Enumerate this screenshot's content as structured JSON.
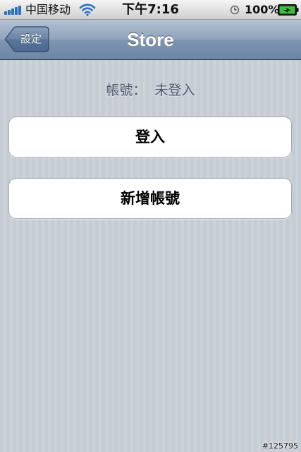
{
  "status_bar": {
    "carrier": "中国移动",
    "time": "下午7:16",
    "battery_percent": "100%",
    "signal_icon": "signal-bars-icon",
    "wifi_icon": "wifi-icon",
    "alarm_icon": "clock-icon",
    "battery_icon": "battery-charging-icon",
    "accent": "#2b6fc4"
  },
  "nav_bar": {
    "back_label": "設定",
    "title": "Store"
  },
  "account": {
    "label": "帳號：",
    "value": "未登入"
  },
  "buttons": {
    "login": "登入",
    "create_account": "新增帳號"
  },
  "watermark": "#125795"
}
